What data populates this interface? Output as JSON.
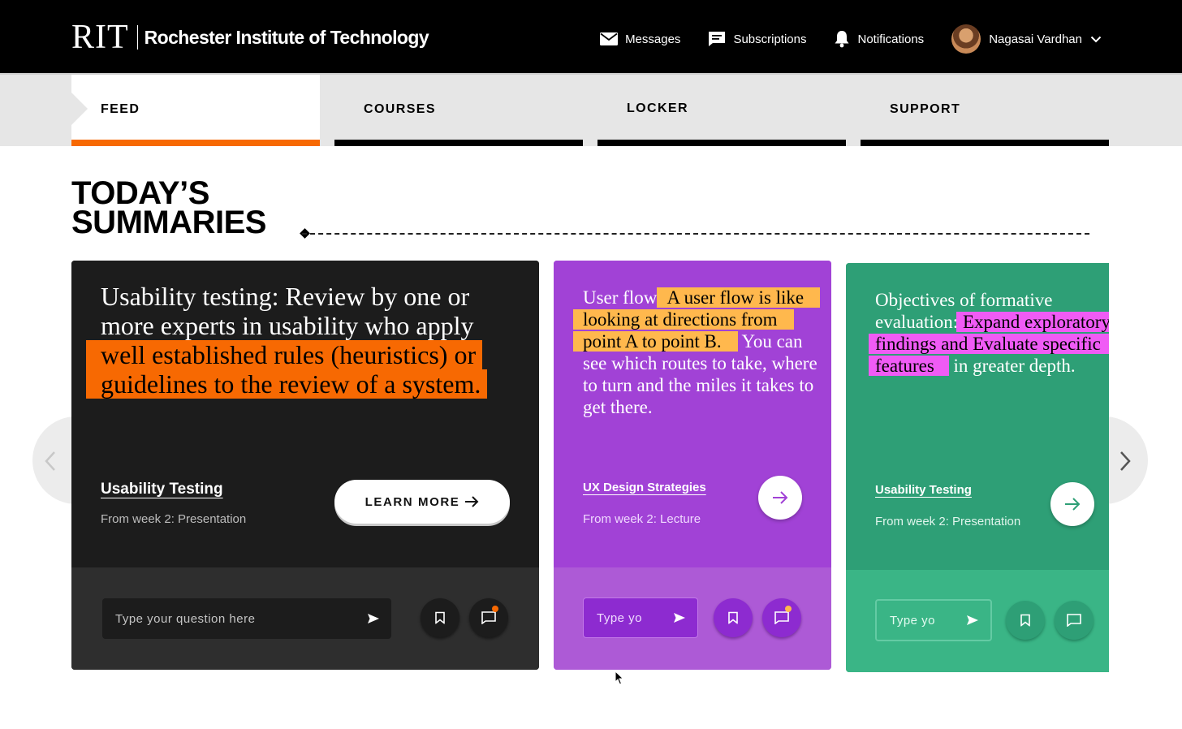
{
  "header": {
    "logo_mark": "RIT",
    "logo_text": "Rochester Institute of Technology",
    "nav": {
      "messages": "Messages",
      "subscriptions": "Subscriptions",
      "notifications": "Notifications",
      "user": "Nagasai Vardhan"
    }
  },
  "tabs": [
    {
      "label": "FEED",
      "active": true
    },
    {
      "label": "COURSES",
      "active": false
    },
    {
      "label": "LOCKER",
      "active": false
    },
    {
      "label": "SUPPORT",
      "active": false
    }
  ],
  "section": {
    "title_line1": "TODAY’S",
    "title_line2": "SUMMARIES"
  },
  "cards": [
    {
      "quote_plain": "Usability testing: Review by one or more experts in usability who apply",
      "quote_highlight": "well established rules (heuristics) or guidelines to the review of a system.",
      "quote_tail": "",
      "course": "Usability Testing",
      "week": "From week 2: Presentation",
      "cta": "LEARN MORE",
      "input_placeholder": "Type your question here",
      "has_new_comment": true,
      "colors": {
        "bg": "#1c1c1c",
        "footer": "#2e2e2e",
        "highlight": "#f76902"
      }
    },
    {
      "quote_plain": "User flow:",
      "quote_highlight": "A user flow is like looking at directions from point A to point B.",
      "quote_tail": "You can see which routes to take, where to turn and the miles it takes to get there.",
      "course": "UX Design Strategies",
      "week": "From week 2: Lecture",
      "input_placeholder": "Type yo",
      "has_new_comment": true,
      "colors": {
        "bg": "#a142d6",
        "footer": "#ad5ad6",
        "highlight": "#ffb84d"
      }
    },
    {
      "quote_plain": "Objectives of formative evaluation:",
      "quote_highlight": "Expand exploratory findings and Evaluate specific features",
      "quote_tail": "in greater depth.",
      "course": "Usability Testing",
      "week": "From week 2: Presentation",
      "input_placeholder": "Type yo",
      "has_new_comment": false,
      "colors": {
        "bg": "#2e9f76",
        "footer": "#3ab586",
        "highlight": "#f05bf5"
      }
    }
  ],
  "colors": {
    "brand_orange": "#f76902",
    "header_bg": "#000000",
    "tabbar_bg": "#e6e6e6"
  }
}
